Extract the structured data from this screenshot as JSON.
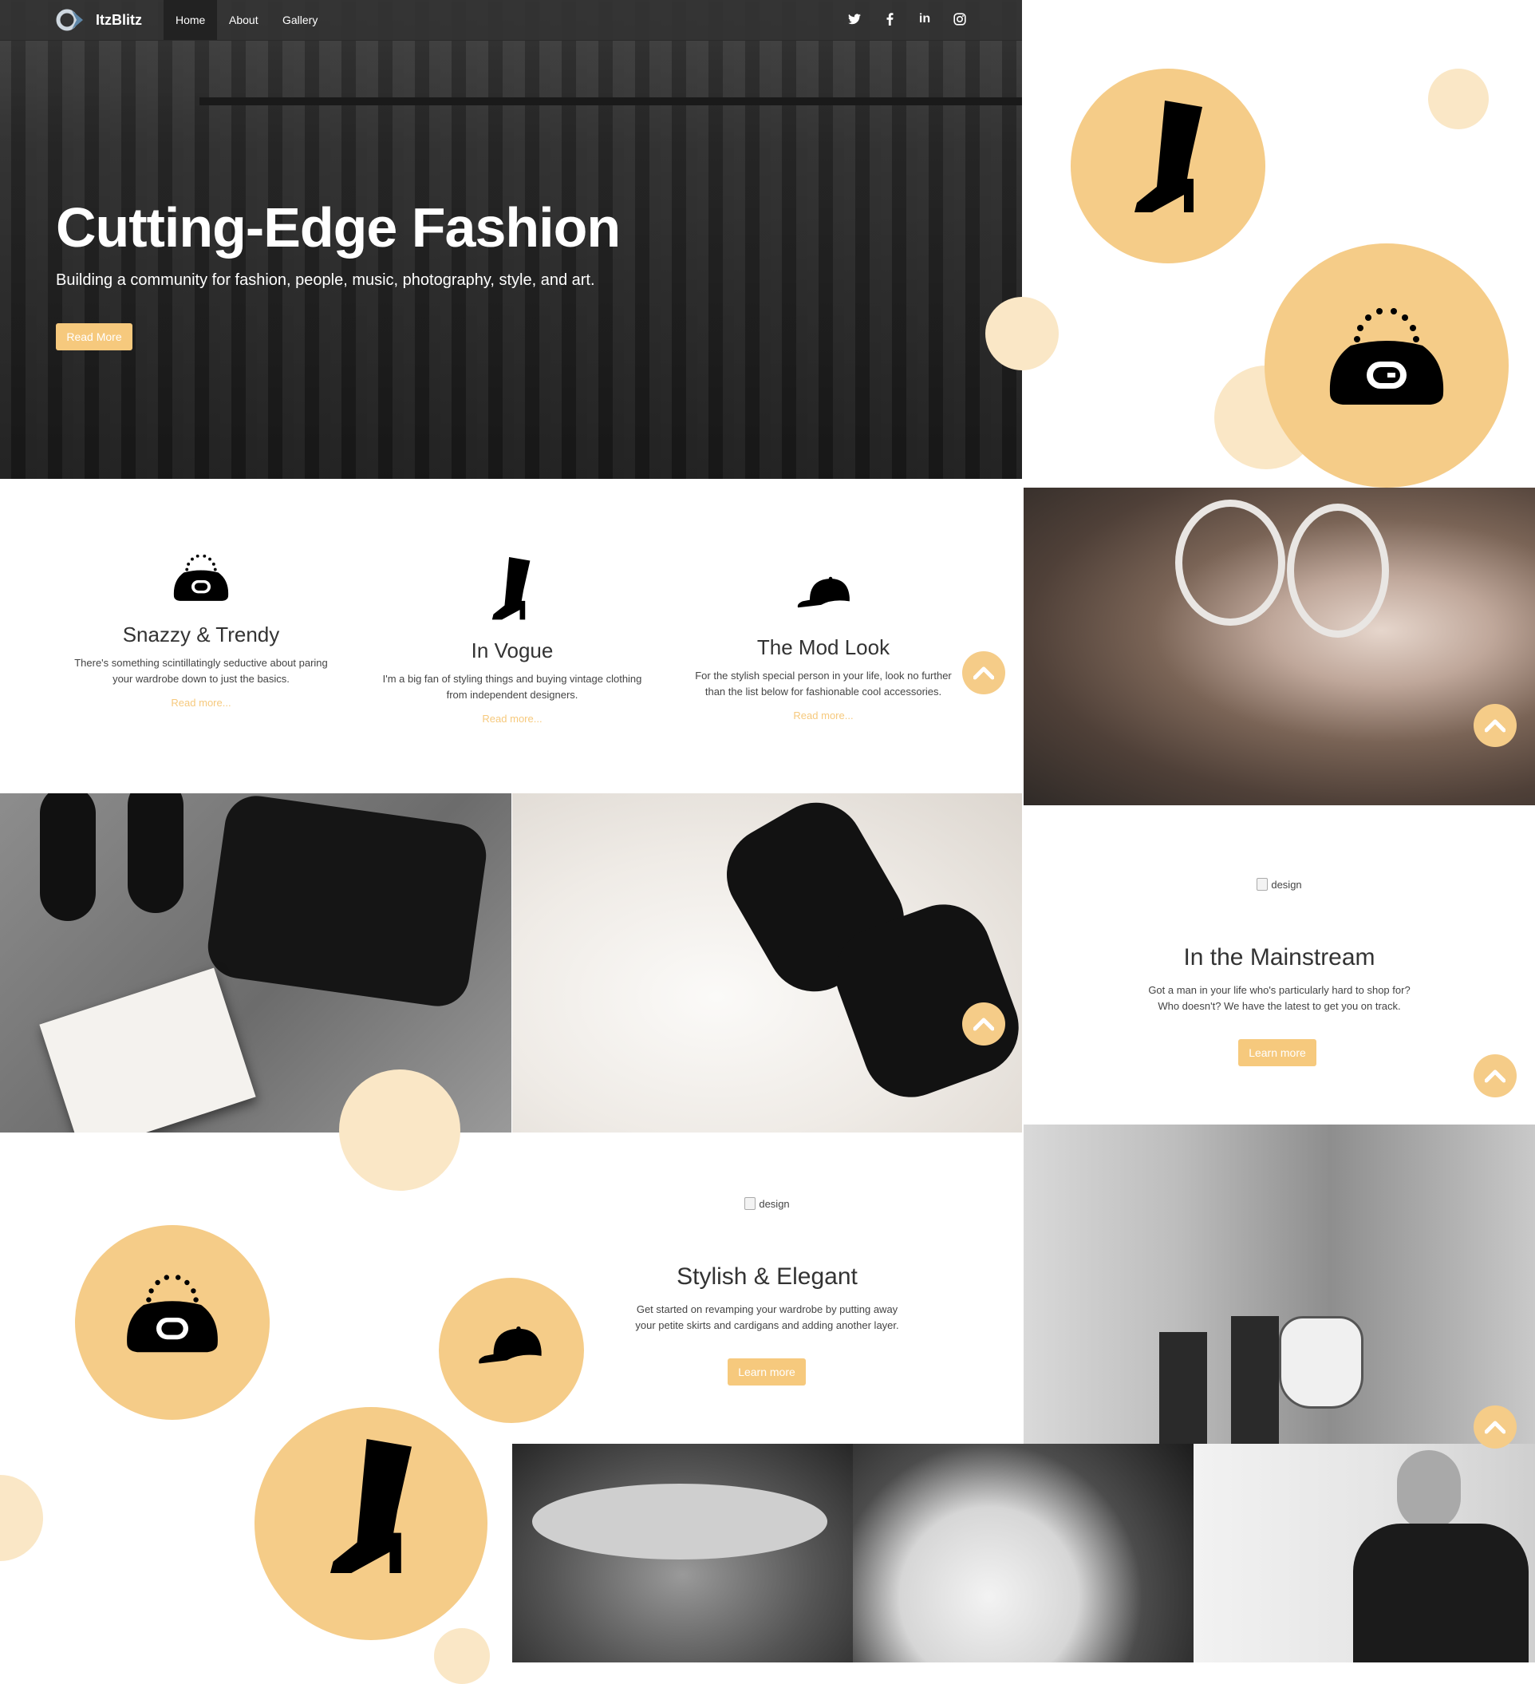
{
  "nav": {
    "brand": "ItzBlitz",
    "links": [
      "Home",
      "About",
      "Gallery"
    ],
    "social": [
      "twitter-icon",
      "facebook-icon",
      "linkedin-icon",
      "instagram-icon"
    ]
  },
  "hero": {
    "title": "Cutting-Edge Fashion",
    "subtitle": "Building a community for fashion, people, music, photography, style, and art.",
    "button": "Read More"
  },
  "features": [
    {
      "icon": "purse-icon",
      "title": "Snazzy & Trendy",
      "text_line1": "There's something scintillatingly seductive about paring",
      "text_line2": "your wardrobe down to just the basics.",
      "link": "Read more..."
    },
    {
      "icon": "boot-icon",
      "title": "In Vogue",
      "text_line1": "I'm a big fan of styling things and buying vintage clothing",
      "text_line2": "from independent designers.",
      "link": "Read more..."
    },
    {
      "icon": "cap-icon",
      "title": "The Mod Look",
      "text_line1": "For the stylish special person in your life, look no further",
      "text_line2": "than the list below for fashionable cool accessories.",
      "link": "Read more..."
    }
  ],
  "mainstream": {
    "img_alt": "design",
    "title": "In the Mainstream",
    "text_line1": "Got a man in your life who's particularly hard to shop for?",
    "text_line2": "Who doesn't? We have the latest to get you on track.",
    "button": "Learn more"
  },
  "elegant": {
    "img_alt": "design",
    "title": "Stylish & Elegant",
    "text_line1": "Get started on revamping your wardrobe by putting away",
    "text_line2": "your petite skirts and cardigans and adding another layer.",
    "button": "Learn more"
  },
  "colors": {
    "accent": "#f6c97d",
    "circle_gold": "#f5cc88",
    "circle_pale": "#fae7c6",
    "navbar": "#333333"
  }
}
